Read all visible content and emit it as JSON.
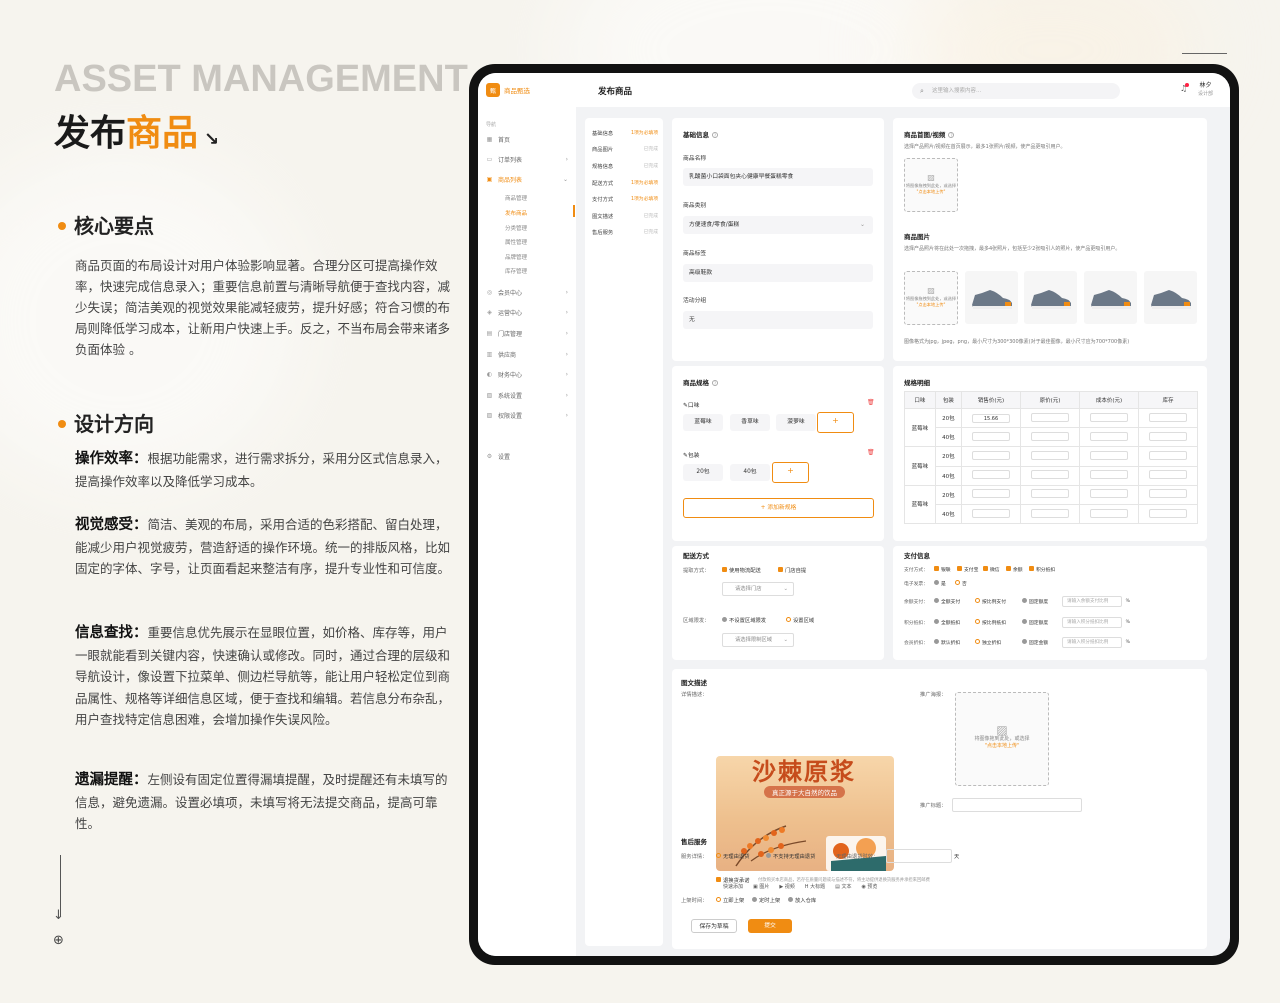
{
  "left": {
    "hero_en": "ASSET MANAGEMENT",
    "hero_zh_a": "发布",
    "hero_zh_b": "商品",
    "sec1_title": "核心要点",
    "sec1_body": "商品页面的布局设计对用户体验影响显著。合理分区可提高操作效率，快速完成信息录入；重要信息前置与清晰导航便于查找内容，减少失误；简洁美观的视觉效果能减轻疲劳，提升好感；符合习惯的布局则降低学习成本，让新用户快速上手。反之，不当布局会带来诸多负面体验 。",
    "sec2_title": "设计方向",
    "dirs": [
      {
        "k": "操作效率：",
        "v": "根据功能需求，进行需求拆分，采用分区式信息录入，提高操作效率以及降低学习成本。"
      },
      {
        "k": "视觉感受：",
        "v": "简洁、美观的布局，采用合适的色彩搭配、留白处理，能减少用户视觉疲劳，营造舒适的操作环境。统一的排版风格，比如固定的字体、字号，让页面看起来整洁有序，提升专业性和可信度。"
      },
      {
        "k": "信息查找：",
        "v": "重要信息优先展示在显眼位置，如价格、库存等，用户一眼就能看到关键内容，快速确认或修改。同时，通过合理的层级和导航设计，像设置下拉菜单、侧边栏导航等，能让用户轻松定位到商品属性、规格等详细信息区域，便于查找和编辑。若信息分布杂乱，用户查找特定信息困难，会增加操作失误风险。"
      },
      {
        "k": "遗漏提醒：",
        "v": "左侧设有固定位置得漏填提醒，及时提醒还有未填写的信息，避免遗漏。设置必填项，未填写将无法提交商品，提高可靠性。"
      }
    ]
  },
  "app": {
    "logo": "商品甄选",
    "logo_mark": "甄",
    "nav_label": "导航",
    "nav": [
      {
        "label": "首页",
        "icon": "▦"
      },
      {
        "label": "订单列表",
        "icon": "▭"
      },
      {
        "label": "商品列表",
        "icon": "▣"
      }
    ],
    "sub": [
      "商品管理",
      "发布商品",
      "分类管理",
      "属性管理",
      "品牌管理",
      "库存管理"
    ],
    "nav2": [
      {
        "label": "会员中心",
        "icon": "◎"
      },
      {
        "label": "运营中心",
        "icon": "◈"
      },
      {
        "label": "门店管理",
        "icon": "▤"
      },
      {
        "label": "供应商",
        "icon": "▥"
      },
      {
        "label": "财务中心",
        "icon": "◐"
      },
      {
        "label": "系统设置",
        "icon": "▧"
      },
      {
        "label": "权限设置",
        "icon": "▨"
      }
    ],
    "settings": "设置",
    "page_title": "发布商品",
    "search_placeholder": "这里输入搜索内容...",
    "user_name": "林夕",
    "user_role": "设计部"
  },
  "steps": [
    {
      "name": "基础信息",
      "state": "1项为必填项",
      "req": true
    },
    {
      "name": "商品图片",
      "state": "已完成",
      "req": false
    },
    {
      "name": "规格信息",
      "state": "已完成",
      "req": false
    },
    {
      "name": "配送方式",
      "state": "1项为必填项",
      "req": true
    },
    {
      "name": "支付方式",
      "state": "1项为必填项",
      "req": true
    },
    {
      "name": "图文描述",
      "state": "已完成",
      "req": false
    },
    {
      "name": "售后服务",
      "state": "已完成",
      "req": false
    }
  ],
  "basic": {
    "title": "基础信息",
    "name_label": "商品名称",
    "name_value": "乳酸菌小口袋面包夹心健康早餐蛋糕零食",
    "cat_label": "商品类别",
    "cat_value": "方便速食/零食/蛋糕",
    "tag_label": "商品标签",
    "tag_value": "高级鞋款",
    "group_label": "活动分组",
    "group_value": "无"
  },
  "media": {
    "title": "商品首图/视频",
    "hint": "选择产品照片/视频在首页展示，最多1张照片/视频，使产品更吸引用户。",
    "upload_text": "将图像拖拽到此处，或选择",
    "upload_link": "\"点击本地上传\"",
    "img_title": "商品图片",
    "img_hint": "选择产品照片将在此处一次拖拽，最多4张照片，包括至少2张吸引人的照片，使产品更吸引用户。",
    "format_hint": "图像格式为jpg，jpeg，png，最小尺寸为300*300像素(对于最佳图像，最小尺寸应为700*700像素)"
  },
  "spec": {
    "title": "商品规格",
    "g1": "口味",
    "g1_items": [
      "蓝莓味",
      "香草味",
      "菠萝味"
    ],
    "g2": "包装",
    "g2_items": [
      "20包",
      "40包"
    ],
    "plus": "+",
    "add": "+ 添加新规格"
  },
  "detail": {
    "title": "规格明细",
    "headers": [
      "口味",
      "包装",
      "销售价(元)",
      "原价(元)",
      "成本价(元)",
      "库存"
    ],
    "rows": [
      {
        "flavor": "蓝莓味",
        "pack": "20包",
        "price": "15.66"
      },
      {
        "flavor": "",
        "pack": "40包",
        "price": ""
      },
      {
        "flavor": "蓝莓味",
        "pack": "20包",
        "price": ""
      },
      {
        "flavor": "",
        "pack": "40包",
        "price": ""
      },
      {
        "flavor": "蓝莓味",
        "pack": "20包",
        "price": ""
      },
      {
        "flavor": "",
        "pack": "40包",
        "price": ""
      }
    ]
  },
  "ship": {
    "title": "配送方式",
    "method_label": "提取方式：",
    "opt1": "使用物流配送",
    "opt2": "门店自提",
    "store_sel": "请选择门店",
    "area_label": "区域限发：",
    "area1": "不设置区域限发",
    "area2": "设置区域",
    "area_sel": "请选择限制区域"
  },
  "pay": {
    "title": "支付信息",
    "method_label": "支付方式：",
    "methods": [
      "银联",
      "支付宝",
      "微信",
      "余额",
      "积分抵扣"
    ],
    "invoice_label": "电子发票：",
    "inv1": "是",
    "inv2": "否",
    "balance_label": "余额支付：",
    "points_label": "积分抵扣：",
    "member_label": "会员折扣：",
    "b_opts": [
      "全额支付",
      "按比例支付",
      "固定额度"
    ],
    "p_opts": [
      "全额抵扣",
      "按比例抵扣",
      "固定额度"
    ],
    "m_opts": [
      "默认折扣",
      "独立折扣",
      "固定金额"
    ],
    "b_input": "请输入余额支付比例",
    "p_input": "请输入积分抵扣比例",
    "m_input": "请输入积分抵扣比例",
    "pct": "%"
  },
  "desc": {
    "title": "图文描述",
    "detail_label": "详情描述：",
    "promo_title": "沙棘原浆",
    "promo_sub": "真正源于大自然的饮品",
    "tools": [
      "快速添加",
      "▣ 图片",
      "▶ 视频",
      "H 大标题",
      "▤ 文本",
      "◉ 预览"
    ],
    "poster_label": "推广海报：",
    "poster_text": "将图像拖到此处，或选择",
    "poster_link": "\"点击本地上传\"",
    "ptitle_label": "推广标题："
  },
  "after": {
    "title": "售后服务",
    "svc_label": "服务详情：",
    "svc1": "无理由退货",
    "svc2": "不支持无理由退货",
    "days_label": "无理由退货时效：",
    "days_unit": "天",
    "promise": "退换货承诺",
    "promise_desc": "付款购买本店商品，若存在质量问题或与描述不符，将主动提供退换货服务并承担来回邮费",
    "shelf_label": "上架时间：",
    "shelf": [
      "立即上架",
      "定时上架",
      "放入仓库"
    ],
    "save": "保存为草稿",
    "submit": "提交"
  }
}
